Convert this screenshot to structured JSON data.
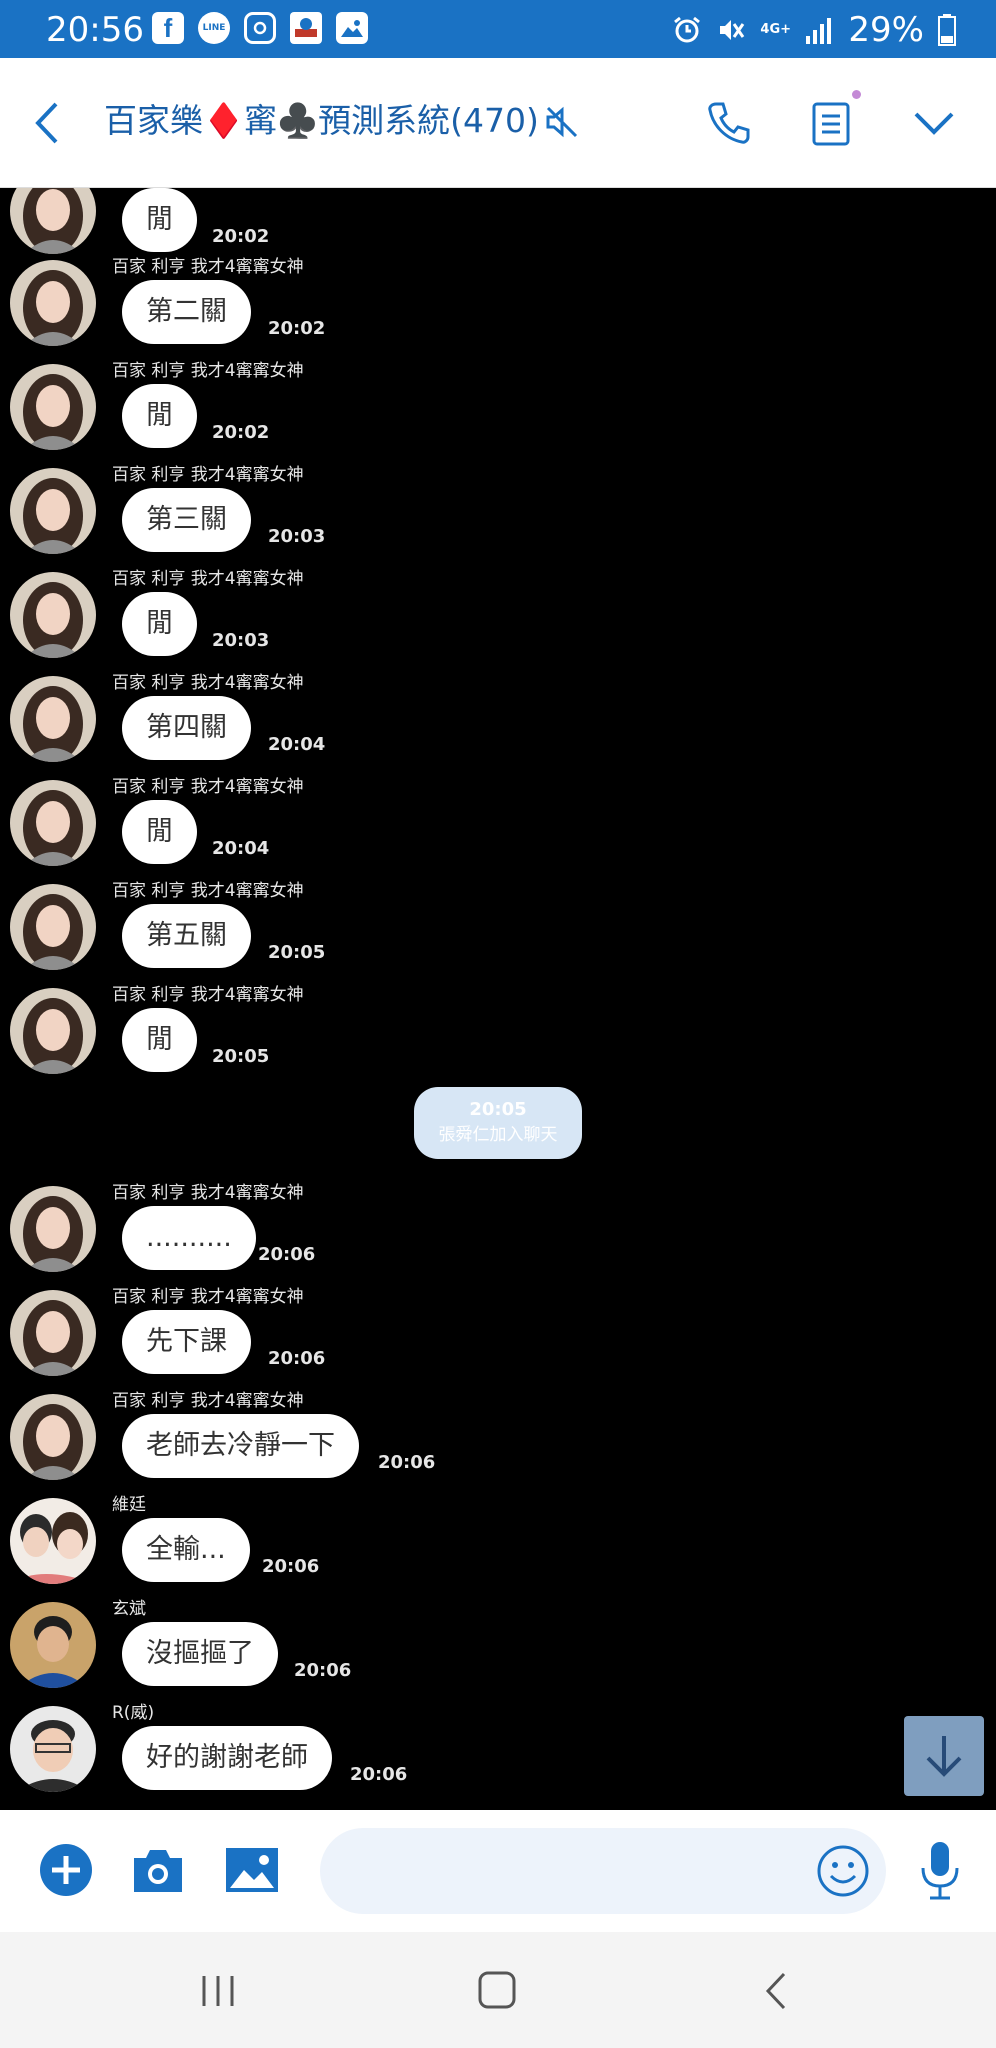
{
  "status_bar": {
    "time": "20:56",
    "network": "4G+",
    "battery": "29%",
    "notification_icons": [
      "facebook-icon",
      "line-icon",
      "instagram-icon",
      "app-icon",
      "gallery-icon"
    ]
  },
  "header": {
    "title": "百家樂♦️寗♣️預測系統(470)",
    "muted": true
  },
  "messages": [
    {
      "sender": "",
      "text": "閒",
      "time": "20:02",
      "avatar": "girl"
    },
    {
      "sender": "百家 利亨 我才4寗寗女神",
      "text": "第二關",
      "time": "20:02",
      "avatar": "girl"
    },
    {
      "sender": "百家 利亨 我才4寗寗女神",
      "text": "閒",
      "time": "20:02",
      "avatar": "girl"
    },
    {
      "sender": "百家 利亨 我才4寗寗女神",
      "text": "第三關",
      "time": "20:03",
      "avatar": "girl"
    },
    {
      "sender": "百家 利亨 我才4寗寗女神",
      "text": "閒",
      "time": "20:03",
      "avatar": "girl"
    },
    {
      "sender": "百家 利亨 我才4寗寗女神",
      "text": "第四關",
      "time": "20:04",
      "avatar": "girl"
    },
    {
      "sender": "百家 利亨 我才4寗寗女神",
      "text": "閒",
      "time": "20:04",
      "avatar": "girl"
    },
    {
      "sender": "百家 利亨 我才4寗寗女神",
      "text": "第五關",
      "time": "20:05",
      "avatar": "girl"
    },
    {
      "sender": "百家 利亨 我才4寗寗女神",
      "text": "閒",
      "time": "20:05",
      "avatar": "girl"
    },
    {
      "sender": "百家 利亨 我才4寗寗女神",
      "text": "..........",
      "time": "20:06",
      "avatar": "girl"
    },
    {
      "sender": "百家 利亨 我才4寗寗女神",
      "text": "先下課",
      "time": "20:06",
      "avatar": "girl"
    },
    {
      "sender": "百家 利亨 我才4寗寗女神",
      "text": "老師去冷靜一下",
      "time": "20:06",
      "avatar": "girl"
    },
    {
      "sender": "維廷",
      "text": "全輸...",
      "time": "20:06",
      "avatar": "couple"
    },
    {
      "sender": "玄斌",
      "text": "沒摳摳了",
      "time": "20:06",
      "avatar": "boy"
    },
    {
      "sender": "R(威)",
      "text": "好的謝謝老師",
      "time": "20:06",
      "avatar": "man"
    }
  ],
  "system_message": {
    "time": "20:05",
    "text": "張舜仁加入聊天"
  },
  "input": {
    "value": "",
    "placeholder": ""
  },
  "colors": {
    "status_bar": "#1a72c4",
    "accent": "#1a72c4",
    "title": "#1a5fa8",
    "chat_background": "#000000",
    "bubble": "#ffffff",
    "scroll_button": "#7f9ebf"
  }
}
